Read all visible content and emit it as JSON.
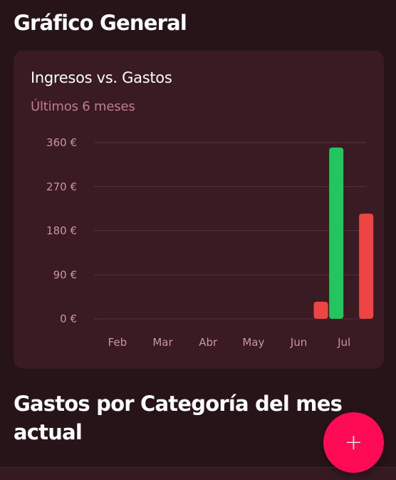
{
  "sections": {
    "general_title": "Gráfico General",
    "categories_title": "Gastos por Categoría del mes actual"
  },
  "card": {
    "title": "Ingresos vs. Gastos",
    "subtitle": "Últimos 6 meses"
  },
  "fab": {
    "label": "+",
    "icon": "plus-icon"
  },
  "colors": {
    "income": "#22c55e",
    "expense": "#ef4444",
    "accent": "#ff0a55",
    "background": "#261419",
    "card": "#3a1b23"
  },
  "chart_data": {
    "type": "bar",
    "title": "Ingresos vs. Gastos",
    "subtitle": "Últimos 6 meses",
    "categories": [
      "Feb",
      "Mar",
      "Abr",
      "May",
      "Jun",
      "Jul"
    ],
    "series": [
      {
        "values": [
          0,
          0,
          0,
          0,
          0,
          350
        ],
        "color": "#22c55e"
      },
      {
        "values": [
          0,
          0,
          0,
          0,
          35,
          215
        ],
        "color": "#ef4444"
      }
    ],
    "yticks": [
      0,
      90,
      180,
      270,
      360
    ],
    "ytick_labels": [
      "0 €",
      "90 €",
      "180 €",
      "270 €",
      "360 €"
    ],
    "ylim": [
      0,
      360
    ],
    "grid": true,
    "legend": "none"
  }
}
